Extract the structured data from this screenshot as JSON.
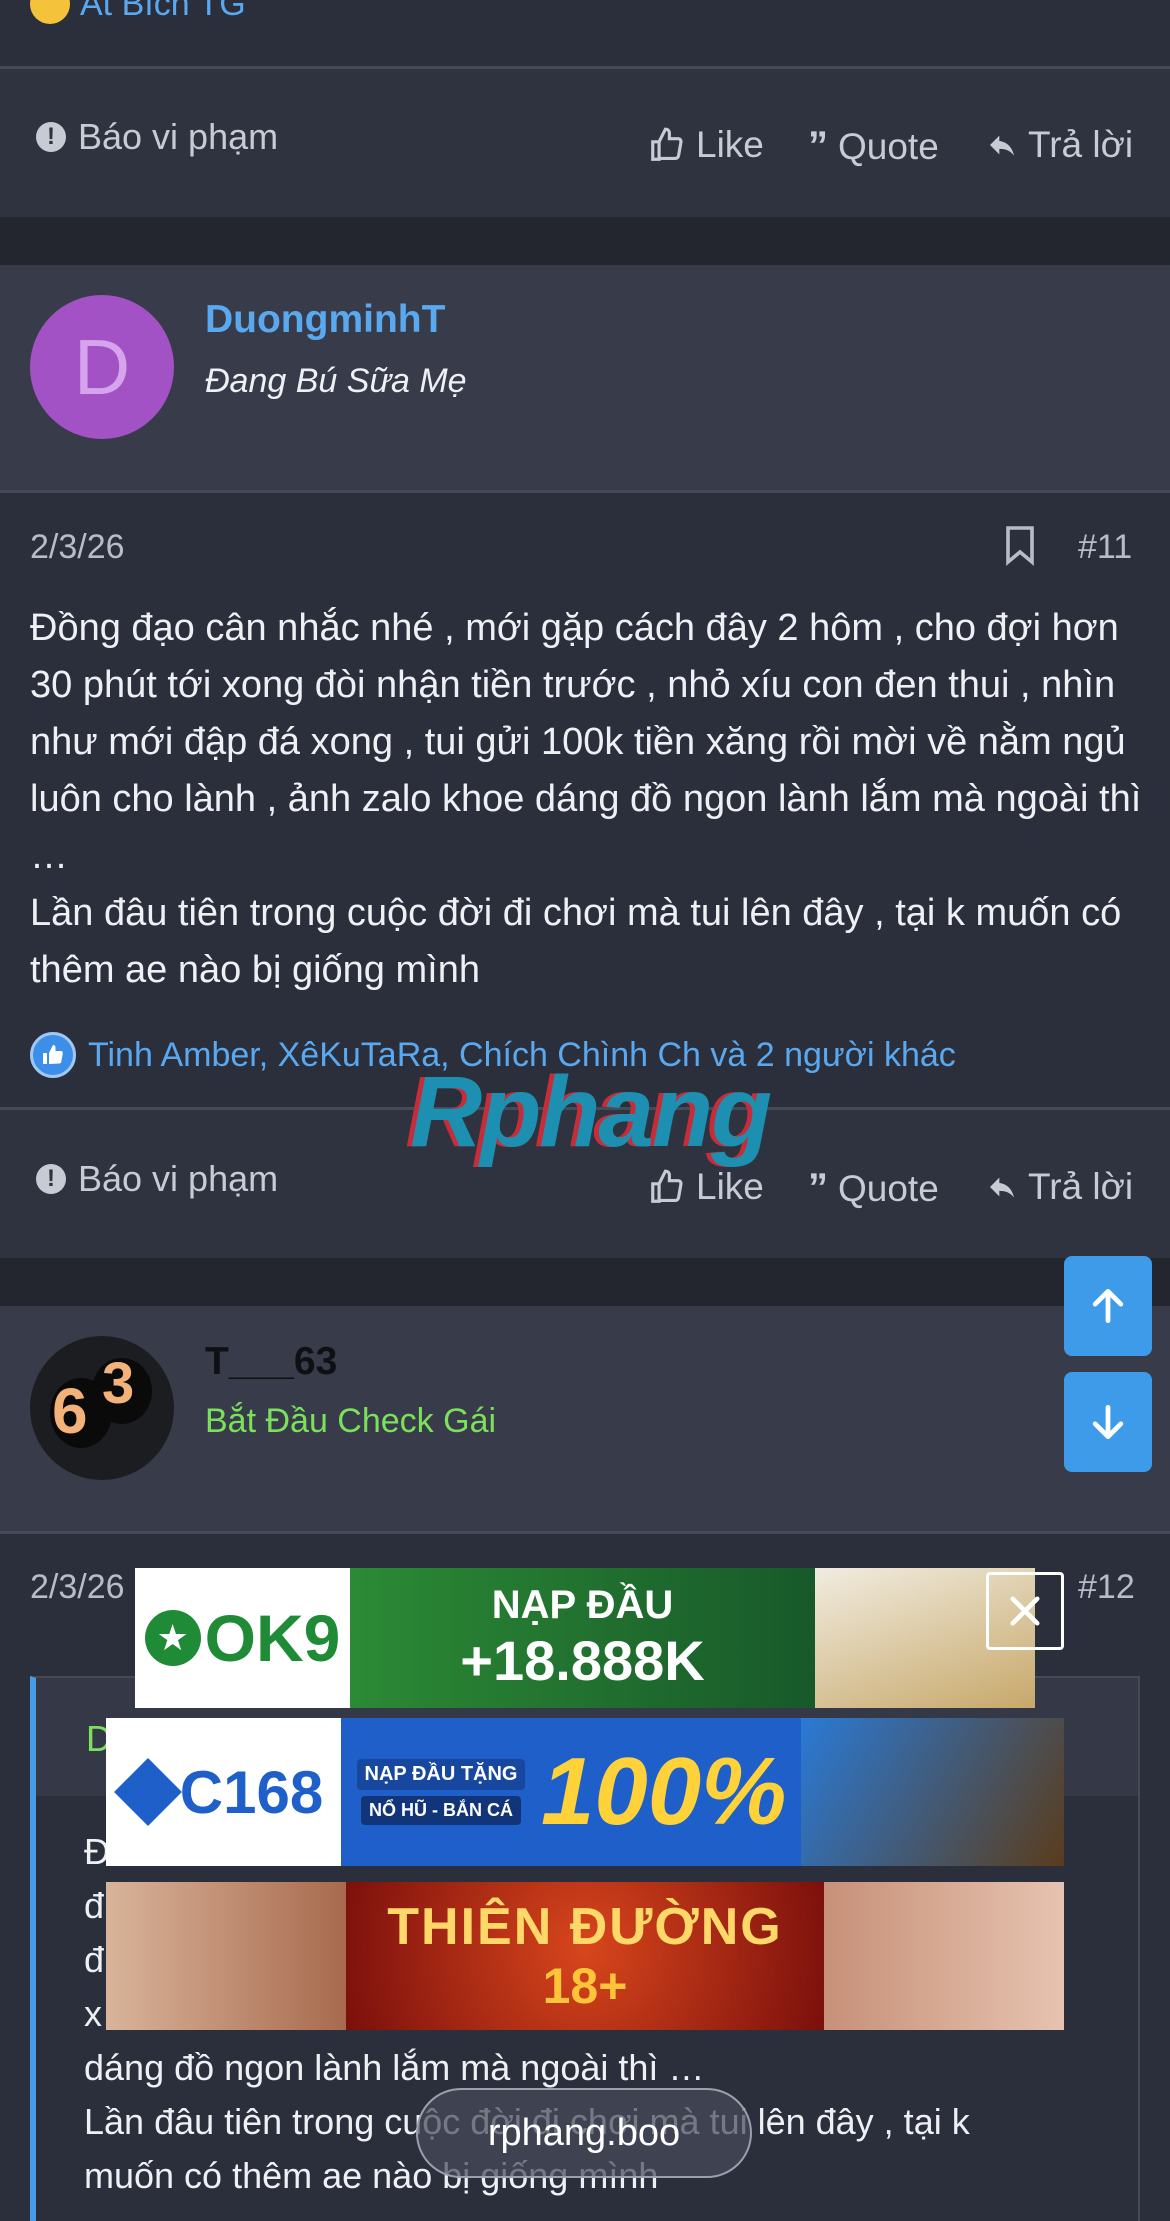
{
  "prev_post": {
    "reactors": "Ất Bích TG",
    "report_label": "Báo vi phạm",
    "like_label": "Like",
    "quote_label": "Quote",
    "reply_label": "Trả lời"
  },
  "post_11": {
    "avatar_letter": "D",
    "avatar_color": "#a352c6",
    "username": "DuongminhT",
    "user_title": "Đang Bú Sữa Mẹ",
    "date": "2/3/26",
    "number": "#11",
    "body": [
      "Đồng đạo cân nhắc nhé , mới gặp cách đây 2 hôm , cho đợi hơn 30 phút tới xong đòi nhận tiền trước , nhỏ xíu con đen thui , nhìn như mới đập đá xong , tui gửi 100k tiền xăng rồi mời về nằm ngủ luôn cho lành , ảnh zalo khoe dáng đồ ngon lành lắm mà ngoài thì …",
      "Lần đâu tiên trong cuộc đời đi chơi mà tui lên đây , tại k muốn có thêm ae nào bị giống mình"
    ],
    "reactors": "Tinh Amber, XêKuTaRa, Chích Chình Ch và 2 người khác",
    "report_label": "Báo vi phạm",
    "like_label": "Like",
    "quote_label": "Quote",
    "reply_label": "Trả lời"
  },
  "watermark": "Rphang",
  "post_12": {
    "avatar_digits": [
      "6",
      "3"
    ],
    "username": "T___63",
    "user_title": "Bắt Đầu Check Gái",
    "user_title_color": "#7be05a",
    "date": "2/3/26",
    "number": "#12",
    "quote_author_initial": "D",
    "quote_lines": [
      "Đ",
      "đ",
      "đ",
      "x",
      "dáng đồ ngon lành lắm mà ngoài thì …",
      "Lần đâu tiên trong cuộc đời đi chơi mà tui lên đây , tại k",
      "muốn có thêm ae nào bị giống mình"
    ]
  },
  "ads": {
    "ok9": {
      "brand": "OK9",
      "headline": "NẠP ĐẦU",
      "amount": "+18.888K"
    },
    "c168": {
      "brand": "C168",
      "tag": "NẠP ĐẦU TẶNG",
      "sub": "NỔ HŨ - BẮN CÁ",
      "percent": "100%"
    },
    "thienduong": {
      "title": "THIÊN ĐƯỜNG",
      "age": "18+"
    }
  },
  "domain_pill": "rphang.boo"
}
